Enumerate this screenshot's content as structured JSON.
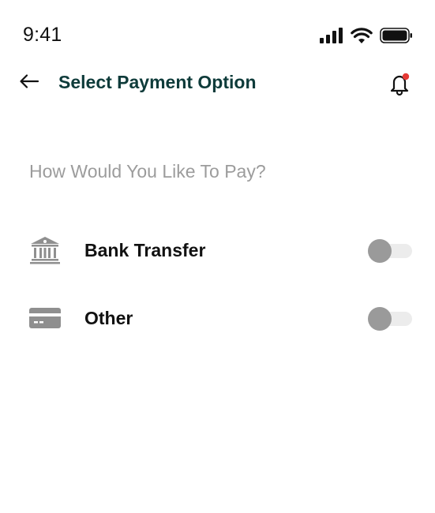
{
  "status_bar": {
    "time": "9:41",
    "icons": [
      "cellular-signal-icon",
      "wifi-icon",
      "battery-icon"
    ]
  },
  "header": {
    "title": "Select Payment Option",
    "back_icon": "arrow-left-icon",
    "notification_icon": "bell-icon",
    "notification_dot_color": "#e53935"
  },
  "main": {
    "question": "How Would You Like To Pay?",
    "options": [
      {
        "label": "Bank Transfer",
        "icon": "bank-icon",
        "enabled": false
      },
      {
        "label": "Other",
        "icon": "credit-card-icon",
        "enabled": false
      }
    ]
  },
  "colors": {
    "title": "#0e3b3a",
    "muted_text": "#9c9c9c",
    "icon_gray": "#8f8f8f",
    "toggle_track": "#ececec",
    "toggle_knob": "#9a9a9a"
  }
}
